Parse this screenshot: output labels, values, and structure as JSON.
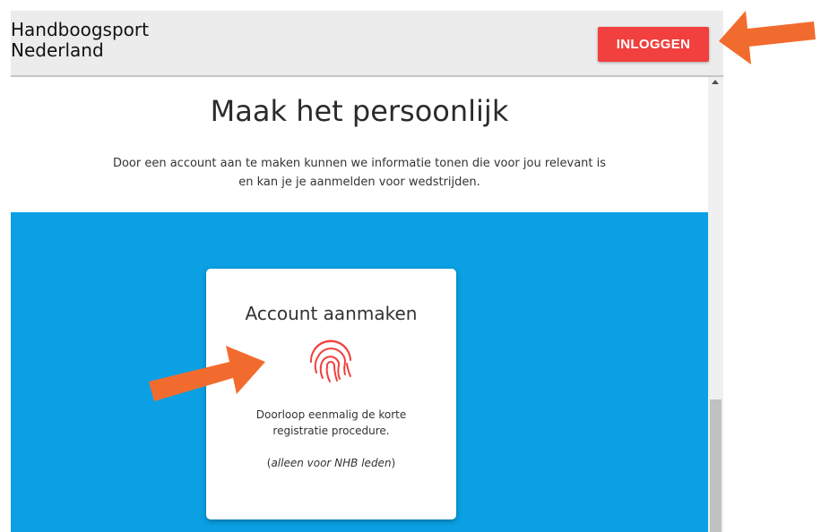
{
  "header": {
    "brand_line1": "Handboogsport",
    "brand_line2": "Nederland",
    "login_label": "INLOGGEN"
  },
  "main": {
    "title": "Maak het persoonlijk",
    "intro_line1": "Door een account aan te maken kunnen we informatie tonen die voor jou relevant is",
    "intro_line2": "en kan je je aanmelden voor wedstrijden."
  },
  "card": {
    "title": "Account aanmaken",
    "icon": "fingerprint-icon",
    "desc_line1": "Doorloop eenmalig de korte",
    "desc_line2": "registratie procedure.",
    "note_open": "(",
    "note_text": "alleen voor NHB leden",
    "note_close": ")"
  },
  "colors": {
    "login_button": "#f1403d",
    "blue_band": "#0aa0e3",
    "annotation_arrow": "#f26b2e",
    "fingerprint": "#f1403d"
  }
}
